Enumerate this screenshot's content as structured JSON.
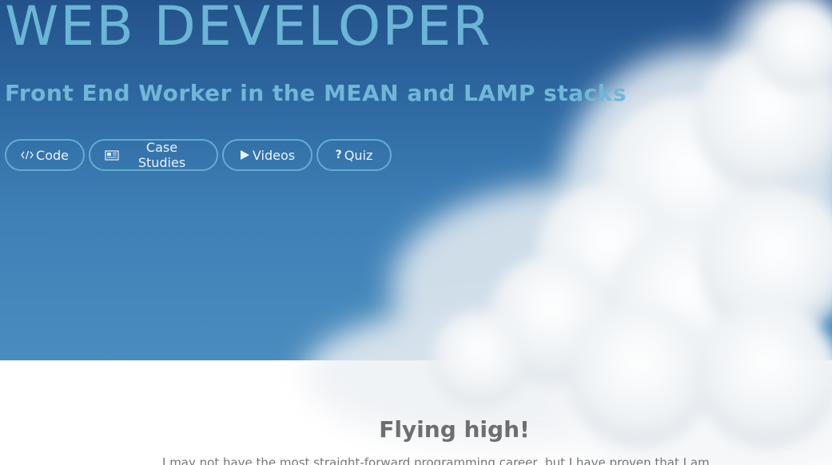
{
  "hero": {
    "title": "WEB DEVELOPER",
    "subtitle": "Front End Worker in the MEAN and LAMP stacks"
  },
  "nav": {
    "code_label": "Code",
    "case_studies_label": "Case Studies",
    "videos_label": "Videos",
    "quiz_label": "Quiz"
  },
  "about": {
    "heading": "Flying high!",
    "intro": "I may not have the most straight-forward programming career, but I have proven that I am"
  },
  "colors": {
    "sky_top": "#23528a",
    "sky_bottom": "#4a8cbe",
    "accent": "#6bb5d6",
    "button_border": "#63add3"
  },
  "icons": [
    "code-icon",
    "newspaper-icon",
    "play-icon",
    "question-icon"
  ]
}
